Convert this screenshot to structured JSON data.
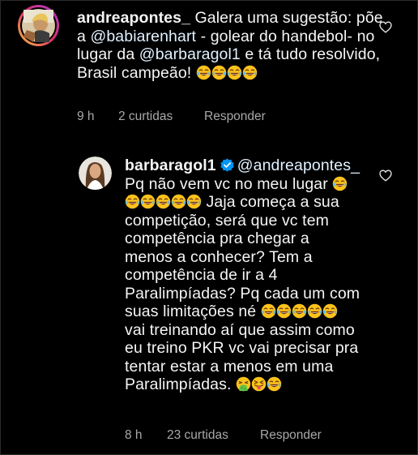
{
  "comments": [
    {
      "username": "andreapontes_",
      "text_a": " Galera uma sugestão: põe a ",
      "mention_1": "@babiarenhart",
      "text_b": " - golear do handebol- no lugar da ",
      "mention_2": "@barbaragol1",
      "text_c": " e tá tudo resolvido, Brasil campeão!",
      "time": "9 h",
      "likes": "2 curtidas",
      "reply_label": "Responder"
    },
    {
      "username": "barbaragol1",
      "verified": true,
      "mention": "@andreapontes_",
      "text_a": " Pq não vem vc no meu lugar",
      "text_b": " Jaja começa a sua competição, será que vc tem competência pra chegar a menos a conhecer? Tem a competência de ir a 4 Paralimpíadas? Pq cada um com suas limitações né",
      "text_c": " vai treinando aí que assim como eu treino PKR vc vai precisar pra tentar estar a menos em uma Paralimpíadas.",
      "time": "8 h",
      "likes": "23 curtidas",
      "reply_label": "Responder"
    }
  ],
  "icons": {
    "emoji_laugh": "face-with-tears-of-joy-icon",
    "emoji_vomit": "face-vomiting-icon",
    "emoji_tongue": "squinting-face-with-tongue-icon",
    "heart": "heart-outline-icon",
    "verified": "verified-badge-icon"
  },
  "colors": {
    "background": "#000000",
    "text": "#f5f5f5",
    "meta": "#a8a8a8",
    "verified": "#0095f6"
  }
}
